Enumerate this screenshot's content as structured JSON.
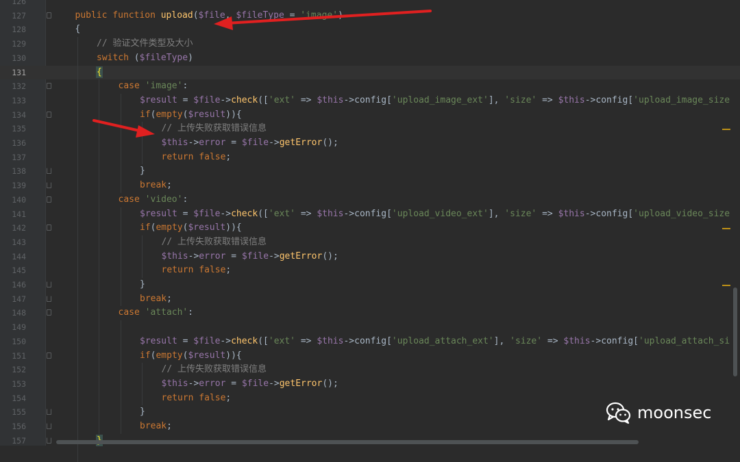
{
  "editor": {
    "lines": [
      {
        "num": "126",
        "indent": 0,
        "parts": []
      },
      {
        "num": "127",
        "indent": 1,
        "parts": [
          [
            "kw",
            "public function "
          ],
          [
            "fn",
            "upload"
          ],
          [
            "plain",
            "("
          ],
          [
            "var",
            "$file"
          ],
          [
            "plain",
            ", "
          ],
          [
            "var",
            "$fileType"
          ],
          [
            "plain",
            " = "
          ],
          [
            "str",
            "'image'"
          ],
          [
            "plain",
            ")"
          ]
        ]
      },
      {
        "num": "128",
        "indent": 1,
        "parts": [
          [
            "plain",
            "{"
          ]
        ]
      },
      {
        "num": "129",
        "indent": 2,
        "parts": [
          [
            "cmt",
            "// 验证文件类型及大小"
          ]
        ]
      },
      {
        "num": "130",
        "indent": 2,
        "parts": [
          [
            "kw",
            "switch "
          ],
          [
            "plain",
            "("
          ],
          [
            "var",
            "$fileType"
          ],
          [
            "plain",
            ")"
          ]
        ]
      },
      {
        "num": "131",
        "indent": 2,
        "current": true,
        "parts": [
          [
            "hl",
            "{"
          ]
        ]
      },
      {
        "num": "132",
        "indent": 3,
        "parts": [
          [
            "kw",
            "case "
          ],
          [
            "str",
            "'image'"
          ],
          [
            "plain",
            ":"
          ]
        ]
      },
      {
        "num": "133",
        "indent": 4,
        "parts": [
          [
            "var",
            "$result"
          ],
          [
            "plain",
            " = "
          ],
          [
            "var",
            "$file"
          ],
          [
            "plain",
            "->"
          ],
          [
            "fn",
            "check"
          ],
          [
            "plain",
            "(["
          ],
          [
            "str",
            "'ext'"
          ],
          [
            "plain",
            " => "
          ],
          [
            "var",
            "$this"
          ],
          [
            "plain",
            "->config["
          ],
          [
            "str",
            "'upload_image_ext'"
          ],
          [
            "plain",
            "], "
          ],
          [
            "str",
            "'size'"
          ],
          [
            "plain",
            " => "
          ],
          [
            "var",
            "$this"
          ],
          [
            "plain",
            "->config["
          ],
          [
            "str",
            "'upload_image_size"
          ]
        ]
      },
      {
        "num": "134",
        "indent": 4,
        "parts": [
          [
            "kw",
            "if"
          ],
          [
            "plain",
            "("
          ],
          [
            "kw",
            "empty"
          ],
          [
            "plain",
            "("
          ],
          [
            "var",
            "$result"
          ],
          [
            "plain",
            "))"
          ],
          [
            "plain",
            "{"
          ]
        ]
      },
      {
        "num": "135",
        "indent": 5,
        "parts": [
          [
            "cmt",
            "// 上传失败获取错误信息"
          ]
        ]
      },
      {
        "num": "136",
        "indent": 5,
        "parts": [
          [
            "var",
            "$this"
          ],
          [
            "plain",
            "->"
          ],
          [
            "var",
            "error"
          ],
          [
            "plain",
            " = "
          ],
          [
            "var",
            "$file"
          ],
          [
            "plain",
            "->"
          ],
          [
            "fn",
            "getError"
          ],
          [
            "plain",
            "();"
          ]
        ]
      },
      {
        "num": "137",
        "indent": 5,
        "parts": [
          [
            "kw",
            "return false"
          ],
          [
            "plain",
            ";"
          ]
        ]
      },
      {
        "num": "138",
        "indent": 4,
        "parts": [
          [
            "plain",
            "}"
          ]
        ]
      },
      {
        "num": "139",
        "indent": 4,
        "parts": [
          [
            "kw",
            "break"
          ],
          [
            "plain",
            ";"
          ]
        ]
      },
      {
        "num": "140",
        "indent": 3,
        "parts": [
          [
            "kw",
            "case "
          ],
          [
            "str",
            "'video'"
          ],
          [
            "plain",
            ":"
          ]
        ]
      },
      {
        "num": "141",
        "indent": 4,
        "parts": [
          [
            "var",
            "$result"
          ],
          [
            "plain",
            " = "
          ],
          [
            "var",
            "$file"
          ],
          [
            "plain",
            "->"
          ],
          [
            "fn",
            "check"
          ],
          [
            "plain",
            "(["
          ],
          [
            "str",
            "'ext'"
          ],
          [
            "plain",
            " => "
          ],
          [
            "var",
            "$this"
          ],
          [
            "plain",
            "->config["
          ],
          [
            "str",
            "'upload_video_ext'"
          ],
          [
            "plain",
            "], "
          ],
          [
            "str",
            "'size'"
          ],
          [
            "plain",
            " => "
          ],
          [
            "var",
            "$this"
          ],
          [
            "plain",
            "->config["
          ],
          [
            "str",
            "'upload_video_size"
          ]
        ]
      },
      {
        "num": "142",
        "indent": 4,
        "parts": [
          [
            "kw",
            "if"
          ],
          [
            "plain",
            "("
          ],
          [
            "kw",
            "empty"
          ],
          [
            "plain",
            "("
          ],
          [
            "var",
            "$result"
          ],
          [
            "plain",
            "))"
          ],
          [
            "plain",
            "{"
          ]
        ]
      },
      {
        "num": "143",
        "indent": 5,
        "parts": [
          [
            "cmt",
            "// 上传失败获取错误信息"
          ]
        ]
      },
      {
        "num": "144",
        "indent": 5,
        "parts": [
          [
            "var",
            "$this"
          ],
          [
            "plain",
            "->"
          ],
          [
            "var",
            "error"
          ],
          [
            "plain",
            " = "
          ],
          [
            "var",
            "$file"
          ],
          [
            "plain",
            "->"
          ],
          [
            "fn",
            "getError"
          ],
          [
            "plain",
            "();"
          ]
        ]
      },
      {
        "num": "145",
        "indent": 5,
        "parts": [
          [
            "kw",
            "return false"
          ],
          [
            "plain",
            ";"
          ]
        ]
      },
      {
        "num": "146",
        "indent": 4,
        "parts": [
          [
            "plain",
            "}"
          ]
        ]
      },
      {
        "num": "147",
        "indent": 4,
        "parts": [
          [
            "kw",
            "break"
          ],
          [
            "plain",
            ";"
          ]
        ]
      },
      {
        "num": "148",
        "indent": 3,
        "parts": [
          [
            "kw",
            "case "
          ],
          [
            "str",
            "'attach'"
          ],
          [
            "plain",
            ":"
          ]
        ]
      },
      {
        "num": "149",
        "indent": 0,
        "parts": []
      },
      {
        "num": "150",
        "indent": 4,
        "parts": [
          [
            "var",
            "$result"
          ],
          [
            "plain",
            " = "
          ],
          [
            "var",
            "$file"
          ],
          [
            "plain",
            "->"
          ],
          [
            "fn",
            "check"
          ],
          [
            "plain",
            "(["
          ],
          [
            "str",
            "'ext'"
          ],
          [
            "plain",
            " => "
          ],
          [
            "var",
            "$this"
          ],
          [
            "plain",
            "->config["
          ],
          [
            "str",
            "'upload_attach_ext'"
          ],
          [
            "plain",
            "], "
          ],
          [
            "str",
            "'size'"
          ],
          [
            "plain",
            " => "
          ],
          [
            "var",
            "$this"
          ],
          [
            "plain",
            "->config["
          ],
          [
            "str",
            "'upload_attach_si"
          ]
        ]
      },
      {
        "num": "151",
        "indent": 4,
        "parts": [
          [
            "kw",
            "if"
          ],
          [
            "plain",
            "("
          ],
          [
            "kw",
            "empty"
          ],
          [
            "plain",
            "("
          ],
          [
            "var",
            "$result"
          ],
          [
            "plain",
            "))"
          ],
          [
            "plain",
            "{"
          ]
        ]
      },
      {
        "num": "152",
        "indent": 5,
        "parts": [
          [
            "cmt",
            "// 上传失败获取错误信息"
          ]
        ]
      },
      {
        "num": "153",
        "indent": 5,
        "parts": [
          [
            "var",
            "$this"
          ],
          [
            "plain",
            "->"
          ],
          [
            "var",
            "error"
          ],
          [
            "plain",
            " = "
          ],
          [
            "var",
            "$file"
          ],
          [
            "plain",
            "->"
          ],
          [
            "fn",
            "getError"
          ],
          [
            "plain",
            "();"
          ]
        ]
      },
      {
        "num": "154",
        "indent": 5,
        "parts": [
          [
            "kw",
            "return false"
          ],
          [
            "plain",
            ";"
          ]
        ]
      },
      {
        "num": "155",
        "indent": 4,
        "parts": [
          [
            "plain",
            "}"
          ]
        ]
      },
      {
        "num": "156",
        "indent": 4,
        "parts": [
          [
            "kw",
            "break"
          ],
          [
            "plain",
            ";"
          ]
        ]
      },
      {
        "num": "157",
        "indent": 2,
        "parts": [
          [
            "hl",
            "}"
          ]
        ]
      }
    ],
    "fold_marks": {
      "127": "start",
      "132": "start",
      "134": "start",
      "138": "end",
      "139": "end",
      "140": "start",
      "142": "start",
      "146": "end",
      "147": "end",
      "148": "start",
      "151": "start",
      "155": "end",
      "156": "end",
      "157": "end"
    },
    "markers": [
      "135",
      "142",
      "146"
    ]
  },
  "watermark": {
    "text": "moonsec",
    "icon": "wechat-icon"
  },
  "annotations": {
    "arrows": [
      "arrow-to-upload-function",
      "arrow-to-error-comment"
    ],
    "color": "#e02020"
  }
}
